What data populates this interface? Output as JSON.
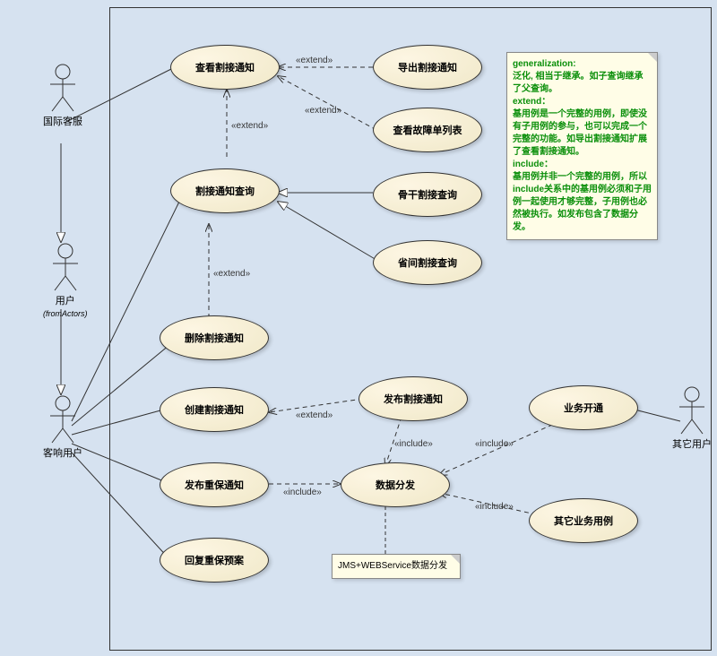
{
  "actors": {
    "intl": "国际客服",
    "user": "用户",
    "user_sub": "(fromActors)",
    "crm": "客响用户",
    "other": "其它用户"
  },
  "usecases": {
    "view_cut": "查看割接通知",
    "export_cut": "导出割接通知",
    "view_fault": "查看故障单列表",
    "cut_query": "割接通知查询",
    "backbone_query": "骨干割接查询",
    "prov_query": "省间割接查询",
    "del_cut": "删除割接通知",
    "create_cut": "创建割接通知",
    "publish_cut": "发布割接通知",
    "biz_open": "业务开通",
    "publish_major": "发布重保通知",
    "data_dist": "数据分发",
    "other_biz": "其它业务用例",
    "reply_plan": "回复重保预案"
  },
  "stereotypes": {
    "extend": "«extend»",
    "include": "«include»"
  },
  "notes": {
    "main": {
      "l1": "generalization:",
      "l2": "泛化, 相当于继承。如子查询继承了父查询。",
      "l3": "extend：",
      "l4": "基用例是一个完整的用例，即使没有子用例的参与，也可以完成一个完整的功能。如导出割接通知扩展了查看割接通知。",
      "l5": "include：",
      "l6": "基用例并非一个完整的用例，所以include关系中的基用例必须和子用例一起使用才够完整，子用例也必然被执行。如发布包含了数据分发。"
    },
    "jms": "JMS+WEBService数据分发"
  }
}
